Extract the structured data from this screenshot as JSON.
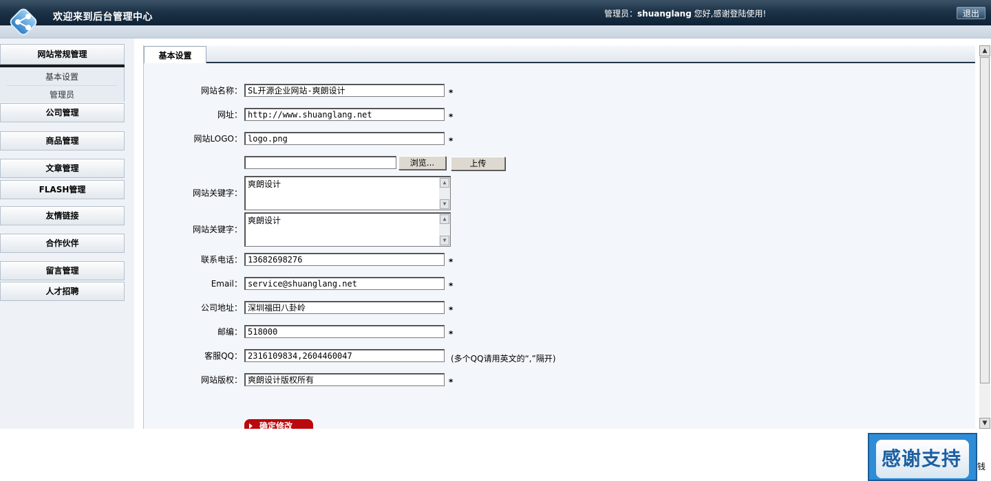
{
  "header": {
    "title": "欢迎来到后台管理中心",
    "welcome_prefix": "管理员：",
    "username": "shuanglang",
    "welcome_suffix": " 您好,感谢登陆使用!",
    "logout_label": "退出",
    "logo_icon": "network-logo-icon"
  },
  "sidebar": {
    "sections": [
      {
        "label": "网站常规管理",
        "expanded": true,
        "items": [
          "基本设置",
          "管理员"
        ]
      },
      {
        "label": "公司管理"
      },
      {
        "label": "商品管理"
      },
      {
        "label": "文章管理"
      },
      {
        "label": "FLASH管理"
      },
      {
        "label": "友情链接"
      },
      {
        "label": "合作伙伴"
      },
      {
        "label": "留言管理"
      },
      {
        "label": "人才招聘"
      }
    ]
  },
  "main": {
    "tab_label": "基本设置",
    "fields": {
      "site_name": {
        "label": "网站名称：",
        "value": "SL开源企业网站-爽朗设计",
        "required": "*"
      },
      "url": {
        "label": "网址：",
        "value": "http://www.shuanglang.net",
        "required": "*"
      },
      "logo": {
        "label": "网站LOGO：",
        "value": "logo.png",
        "required": "*"
      },
      "upload": {
        "browse_label": "浏览...",
        "upload_label": "上传",
        "file_value": ""
      },
      "keywords": {
        "label": "网站关键字：",
        "value": "爽朗设计"
      },
      "description": {
        "label": "网站关键字：",
        "value": "爽朗设计"
      },
      "phone": {
        "label": "联系电话：",
        "value": "13682698276",
        "required": "*"
      },
      "email": {
        "label": "Email：",
        "value": "service@shuanglang.net",
        "required": "*"
      },
      "address": {
        "label": "公司地址：",
        "value": "深圳福田八卦岭",
        "required": "*"
      },
      "zip": {
        "label": "邮编：",
        "value": "518000",
        "required": "*"
      },
      "qq": {
        "label": "客服QQ：",
        "value": "2316109834,2604460047",
        "hint": "(多个QQ请用英文的“,”隔开)"
      },
      "copyright": {
        "label": "网站版权：",
        "value": "爽朗设计版权所有",
        "required": "*"
      }
    },
    "submit_label": "确定修改"
  },
  "badge": {
    "text": "感谢支持",
    "cut_text": "钱"
  },
  "colors": {
    "header_dark": "#0f2236",
    "submit_red": "#b9090c",
    "badge_blue": "#2e8dd6"
  }
}
